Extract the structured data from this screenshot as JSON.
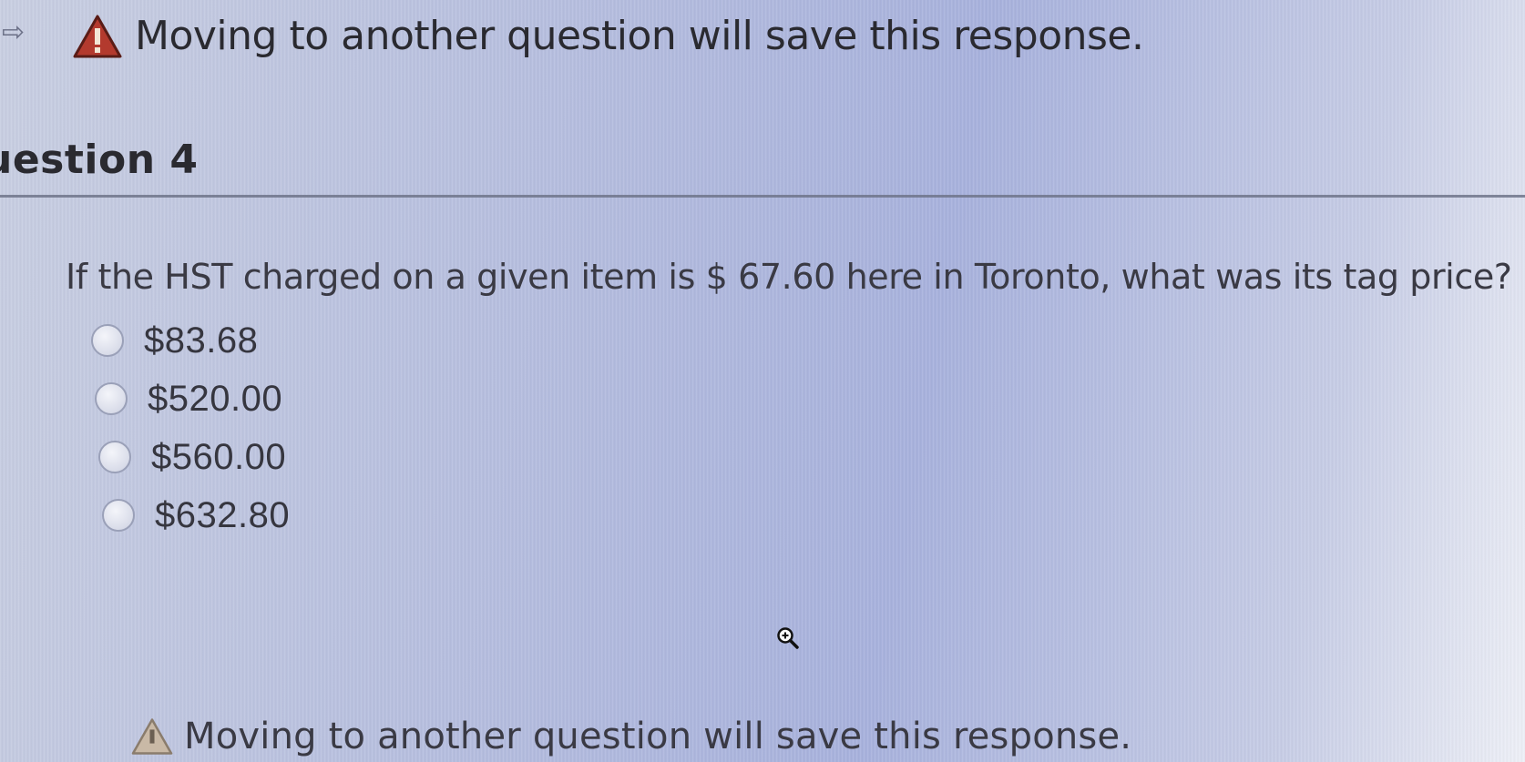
{
  "banner": {
    "warning_text": "Moving to another question will save this response.",
    "icon": "warning-triangle-icon"
  },
  "question": {
    "title": "uestion 4",
    "text": "If the HST charged on a given item is $ 67.60 here in Toronto, what was its tag price?",
    "options": [
      {
        "label": "$83.68"
      },
      {
        "label": "$520.00"
      },
      {
        "label": "$560.00"
      },
      {
        "label": "$632.80"
      }
    ]
  },
  "footer": {
    "warning_text": "Moving to another question will save this response.",
    "icon": "warning-triangle-icon"
  },
  "colors": {
    "warning_red": "#b33a2e",
    "text": "#2a2a30"
  }
}
